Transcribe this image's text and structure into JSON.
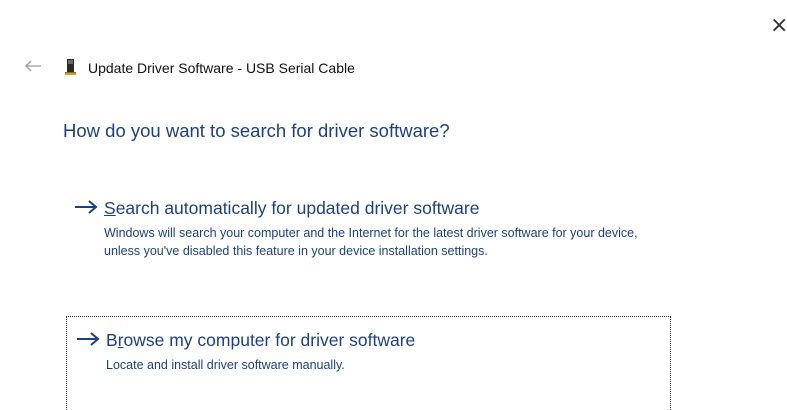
{
  "window": {
    "title": "Update Driver Software - USB Serial Cable",
    "close_glyph": "×",
    "close_icon": "close-icon",
    "back_icon": "back-arrow-icon",
    "device_icon": "usb-device-icon"
  },
  "heading": "How do you want to search for driver software?",
  "options": [
    {
      "title_accel": "S",
      "title_rest": "earch automatically for updated driver software",
      "description": "Windows will search your computer and the Internet for the latest driver software for your device, unless you've disabled this feature in your device installation settings.",
      "icon": "right-arrow-icon"
    },
    {
      "title_pre": "B",
      "title_accel": "r",
      "title_rest": "owse my computer for driver software",
      "description": "Locate and install driver software manually.",
      "icon": "right-arrow-icon",
      "focused": true
    }
  ],
  "colors": {
    "link_blue": "#1c3f8c",
    "text": "#111111",
    "background": "#ffffff"
  }
}
